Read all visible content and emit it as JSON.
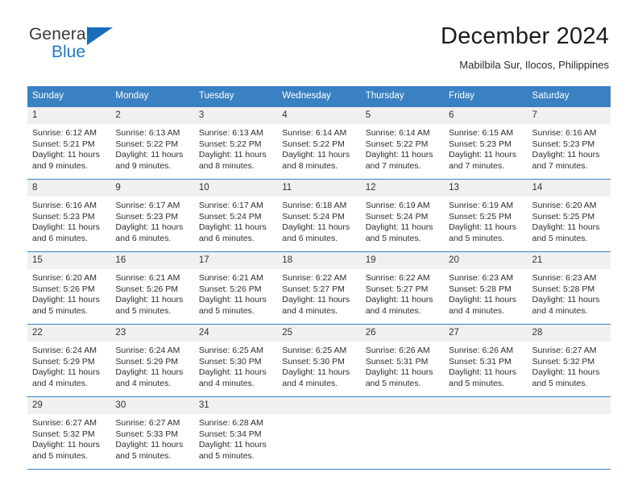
{
  "brand": {
    "line1": "General",
    "line2": "Blue",
    "triangle_icon": "triangle-logo-icon",
    "colors": {
      "top_text": "#3a3a3a",
      "bottom_text": "#2079c7",
      "triangle": "#1b6dbb"
    }
  },
  "header": {
    "title": "December 2024",
    "subtitle": "Mabilbila Sur, Ilocos, Philippines"
  },
  "calendar": {
    "accent_color": "#3a81c4",
    "daynum_bg": "#f0f0f0",
    "weekday_headers": [
      "Sunday",
      "Monday",
      "Tuesday",
      "Wednesday",
      "Thursday",
      "Friday",
      "Saturday"
    ],
    "weeks": [
      [
        {
          "day": "1",
          "sunrise": "Sunrise: 6:12 AM",
          "sunset": "Sunset: 5:21 PM",
          "daylight": "Daylight: 11 hours and 9 minutes."
        },
        {
          "day": "2",
          "sunrise": "Sunrise: 6:13 AM",
          "sunset": "Sunset: 5:22 PM",
          "daylight": "Daylight: 11 hours and 9 minutes."
        },
        {
          "day": "3",
          "sunrise": "Sunrise: 6:13 AM",
          "sunset": "Sunset: 5:22 PM",
          "daylight": "Daylight: 11 hours and 8 minutes."
        },
        {
          "day": "4",
          "sunrise": "Sunrise: 6:14 AM",
          "sunset": "Sunset: 5:22 PM",
          "daylight": "Daylight: 11 hours and 8 minutes."
        },
        {
          "day": "5",
          "sunrise": "Sunrise: 6:14 AM",
          "sunset": "Sunset: 5:22 PM",
          "daylight": "Daylight: 11 hours and 7 minutes."
        },
        {
          "day": "6",
          "sunrise": "Sunrise: 6:15 AM",
          "sunset": "Sunset: 5:23 PM",
          "daylight": "Daylight: 11 hours and 7 minutes."
        },
        {
          "day": "7",
          "sunrise": "Sunrise: 6:16 AM",
          "sunset": "Sunset: 5:23 PM",
          "daylight": "Daylight: 11 hours and 7 minutes."
        }
      ],
      [
        {
          "day": "8",
          "sunrise": "Sunrise: 6:16 AM",
          "sunset": "Sunset: 5:23 PM",
          "daylight": "Daylight: 11 hours and 6 minutes."
        },
        {
          "day": "9",
          "sunrise": "Sunrise: 6:17 AM",
          "sunset": "Sunset: 5:23 PM",
          "daylight": "Daylight: 11 hours and 6 minutes."
        },
        {
          "day": "10",
          "sunrise": "Sunrise: 6:17 AM",
          "sunset": "Sunset: 5:24 PM",
          "daylight": "Daylight: 11 hours and 6 minutes."
        },
        {
          "day": "11",
          "sunrise": "Sunrise: 6:18 AM",
          "sunset": "Sunset: 5:24 PM",
          "daylight": "Daylight: 11 hours and 6 minutes."
        },
        {
          "day": "12",
          "sunrise": "Sunrise: 6:19 AM",
          "sunset": "Sunset: 5:24 PM",
          "daylight": "Daylight: 11 hours and 5 minutes."
        },
        {
          "day": "13",
          "sunrise": "Sunrise: 6:19 AM",
          "sunset": "Sunset: 5:25 PM",
          "daylight": "Daylight: 11 hours and 5 minutes."
        },
        {
          "day": "14",
          "sunrise": "Sunrise: 6:20 AM",
          "sunset": "Sunset: 5:25 PM",
          "daylight": "Daylight: 11 hours and 5 minutes."
        }
      ],
      [
        {
          "day": "15",
          "sunrise": "Sunrise: 6:20 AM",
          "sunset": "Sunset: 5:26 PM",
          "daylight": "Daylight: 11 hours and 5 minutes."
        },
        {
          "day": "16",
          "sunrise": "Sunrise: 6:21 AM",
          "sunset": "Sunset: 5:26 PM",
          "daylight": "Daylight: 11 hours and 5 minutes."
        },
        {
          "day": "17",
          "sunrise": "Sunrise: 6:21 AM",
          "sunset": "Sunset: 5:26 PM",
          "daylight": "Daylight: 11 hours and 5 minutes."
        },
        {
          "day": "18",
          "sunrise": "Sunrise: 6:22 AM",
          "sunset": "Sunset: 5:27 PM",
          "daylight": "Daylight: 11 hours and 4 minutes."
        },
        {
          "day": "19",
          "sunrise": "Sunrise: 6:22 AM",
          "sunset": "Sunset: 5:27 PM",
          "daylight": "Daylight: 11 hours and 4 minutes."
        },
        {
          "day": "20",
          "sunrise": "Sunrise: 6:23 AM",
          "sunset": "Sunset: 5:28 PM",
          "daylight": "Daylight: 11 hours and 4 minutes."
        },
        {
          "day": "21",
          "sunrise": "Sunrise: 6:23 AM",
          "sunset": "Sunset: 5:28 PM",
          "daylight": "Daylight: 11 hours and 4 minutes."
        }
      ],
      [
        {
          "day": "22",
          "sunrise": "Sunrise: 6:24 AM",
          "sunset": "Sunset: 5:29 PM",
          "daylight": "Daylight: 11 hours and 4 minutes."
        },
        {
          "day": "23",
          "sunrise": "Sunrise: 6:24 AM",
          "sunset": "Sunset: 5:29 PM",
          "daylight": "Daylight: 11 hours and 4 minutes."
        },
        {
          "day": "24",
          "sunrise": "Sunrise: 6:25 AM",
          "sunset": "Sunset: 5:30 PM",
          "daylight": "Daylight: 11 hours and 4 minutes."
        },
        {
          "day": "25",
          "sunrise": "Sunrise: 6:25 AM",
          "sunset": "Sunset: 5:30 PM",
          "daylight": "Daylight: 11 hours and 4 minutes."
        },
        {
          "day": "26",
          "sunrise": "Sunrise: 6:26 AM",
          "sunset": "Sunset: 5:31 PM",
          "daylight": "Daylight: 11 hours and 5 minutes."
        },
        {
          "day": "27",
          "sunrise": "Sunrise: 6:26 AM",
          "sunset": "Sunset: 5:31 PM",
          "daylight": "Daylight: 11 hours and 5 minutes."
        },
        {
          "day": "28",
          "sunrise": "Sunrise: 6:27 AM",
          "sunset": "Sunset: 5:32 PM",
          "daylight": "Daylight: 11 hours and 5 minutes."
        }
      ],
      [
        {
          "day": "29",
          "sunrise": "Sunrise: 6:27 AM",
          "sunset": "Sunset: 5:32 PM",
          "daylight": "Daylight: 11 hours and 5 minutes."
        },
        {
          "day": "30",
          "sunrise": "Sunrise: 6:27 AM",
          "sunset": "Sunset: 5:33 PM",
          "daylight": "Daylight: 11 hours and 5 minutes."
        },
        {
          "day": "31",
          "sunrise": "Sunrise: 6:28 AM",
          "sunset": "Sunset: 5:34 PM",
          "daylight": "Daylight: 11 hours and 5 minutes."
        },
        {
          "day": "",
          "sunrise": "",
          "sunset": "",
          "daylight": ""
        },
        {
          "day": "",
          "sunrise": "",
          "sunset": "",
          "daylight": ""
        },
        {
          "day": "",
          "sunrise": "",
          "sunset": "",
          "daylight": ""
        },
        {
          "day": "",
          "sunrise": "",
          "sunset": "",
          "daylight": ""
        }
      ]
    ]
  }
}
